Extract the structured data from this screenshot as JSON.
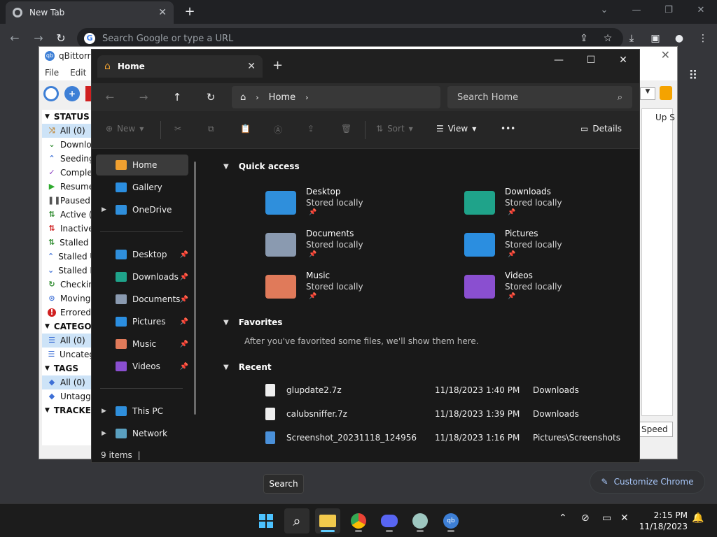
{
  "chrome": {
    "tab_title": "New Tab",
    "omnibox_placeholder": "Search Google or type a URL",
    "customize_label": "Customize Chrome",
    "colors": {
      "frame": "#202124",
      "toolbar": "#35363a",
      "accent": "#a8c7fa"
    }
  },
  "qbittorrent": {
    "title": "qBittorre",
    "menu": [
      "File",
      "Edit"
    ],
    "status_header": "STATUS",
    "status_items": [
      {
        "label": "All (0)",
        "icon": "shuffle-icon",
        "color": "#c08a3e"
      },
      {
        "label": "Downlo",
        "icon": "download-chevron-icon",
        "color": "#2e8b2e"
      },
      {
        "label": "Seeding",
        "icon": "upload-chevron-icon",
        "color": "#3d6fd6"
      },
      {
        "label": "Comple",
        "icon": "check-icon",
        "color": "#8a3ec0"
      },
      {
        "label": "Resume",
        "icon": "play-icon",
        "color": "#2eaa2e"
      },
      {
        "label": "Paused",
        "icon": "pause-icon",
        "color": "#555555"
      },
      {
        "label": "Active (",
        "icon": "active-arrows-icon",
        "color": "#2e8b2e"
      },
      {
        "label": "Inactive",
        "icon": "inactive-arrows-icon",
        "color": "#d02020"
      },
      {
        "label": "Stalled (",
        "icon": "stalled-arrows-icon",
        "color": "#2e8b2e"
      },
      {
        "label": "Stalled U",
        "icon": "stalled-up-icon",
        "color": "#3d6fd6"
      },
      {
        "label": "Stalled D",
        "icon": "stalled-down-icon",
        "color": "#3d6fd6"
      },
      {
        "label": "Checkin",
        "icon": "refresh-icon",
        "color": "#2e8b2e"
      },
      {
        "label": "Moving",
        "icon": "moving-icon",
        "color": "#3d6fd6"
      },
      {
        "label": "Errored",
        "icon": "error-icon",
        "color": "#d02020"
      }
    ],
    "categories_header": "CATEGOR",
    "category_items": [
      "All (0)",
      "Uncateg"
    ],
    "tags_header": "TAGS",
    "tag_items": [
      "All (0)",
      "Untagg"
    ],
    "trackers_header": "TRACKER",
    "up_speed_col": "Up S",
    "speed_label": "Speed"
  },
  "explorer": {
    "tab_title": "Home",
    "breadcrumb": "Home",
    "search_placeholder": "Search Home",
    "commands": {
      "new": "New",
      "sort": "Sort",
      "view": "View",
      "more": "•••",
      "details": "Details"
    },
    "nav": [
      {
        "label": "Home",
        "icon": "home-icon",
        "selected": true
      },
      {
        "label": "Gallery",
        "icon": "gallery-icon"
      },
      {
        "label": "OneDrive",
        "icon": "onedrive-icon",
        "expandable": true
      }
    ],
    "pinned_nav": [
      {
        "label": "Desktop",
        "icon": "desktop-icon"
      },
      {
        "label": "Downloads",
        "icon": "downloads-icon"
      },
      {
        "label": "Documents",
        "icon": "documents-icon"
      },
      {
        "label": "Pictures",
        "icon": "pictures-icon"
      },
      {
        "label": "Music",
        "icon": "music-icon"
      },
      {
        "label": "Videos",
        "icon": "videos-icon"
      }
    ],
    "bottom_nav": [
      {
        "label": "This PC",
        "icon": "this-pc-icon"
      },
      {
        "label": "Network",
        "icon": "network-icon"
      }
    ],
    "quick_access_title": "Quick access",
    "quick_access": [
      {
        "name": "Desktop",
        "sub": "Stored locally",
        "color": "#2f8fdc"
      },
      {
        "name": "Downloads",
        "sub": "Stored locally",
        "color": "#1fa38a"
      },
      {
        "name": "Documents",
        "sub": "Stored locally",
        "color": "#8a9ab0"
      },
      {
        "name": "Pictures",
        "sub": "Stored locally",
        "color": "#2b8ee0"
      },
      {
        "name": "Music",
        "sub": "Stored locally",
        "color": "#e07a5a"
      },
      {
        "name": "Videos",
        "sub": "Stored locally",
        "color": "#8a4fd0"
      }
    ],
    "favorites_title": "Favorites",
    "favorites_note": "After you've favorited some files, we'll show them here.",
    "recent_title": "Recent",
    "recent": [
      {
        "name": "glupdate2.7z",
        "date": "11/18/2023 1:40 PM",
        "location": "Downloads"
      },
      {
        "name": "calubsniffer.7z",
        "date": "11/18/2023 1:39 PM",
        "location": "Downloads"
      },
      {
        "name": "Screenshot_20231118_124956",
        "date": "11/18/2023 1:16 PM",
        "location": "Pictures\\Screenshots"
      }
    ],
    "status": "9 items"
  },
  "tooltip": "Search",
  "taskbar": {
    "time": "2:15 PM",
    "date": "11/18/2023",
    "apps": [
      "start-icon",
      "search-icon",
      "file-explorer-icon",
      "chrome-icon",
      "discord-icon",
      "globe-app-icon",
      "qbittorrent-icon"
    ]
  }
}
